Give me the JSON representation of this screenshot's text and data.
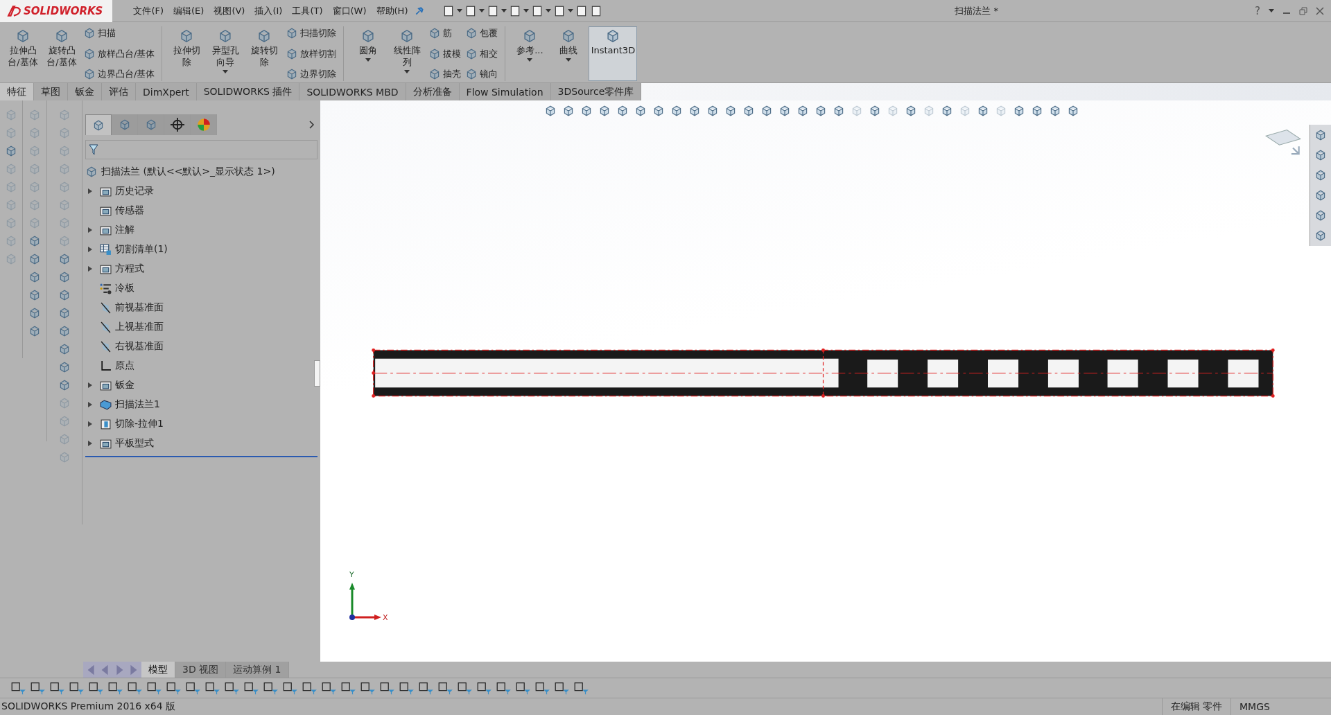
{
  "app_logo": "SOLIDWORKS",
  "menu": [
    "文件(F)",
    "编辑(E)",
    "视图(V)",
    "插入(I)",
    "工具(T)",
    "窗口(W)",
    "帮助(H)"
  ],
  "document_title": "扫描法兰 *",
  "help": "?",
  "ribbon": [
    {
      "kind": "large",
      "label": "拉伸凸台/基体",
      "dropdown": false,
      "on": false
    },
    {
      "kind": "large",
      "label": "旋转凸台/基体",
      "dropdown": false,
      "on": false
    },
    {
      "kind": "stack",
      "items": [
        "扫描",
        "放样凸台/基体",
        "边界凸台/基体"
      ]
    },
    {
      "kind": "separator"
    },
    {
      "kind": "large",
      "label": "拉伸切除",
      "dropdown": false,
      "on": false
    },
    {
      "kind": "large",
      "label": "异型孔向导",
      "dropdown": true,
      "on": false
    },
    {
      "kind": "large",
      "label": "旋转切除",
      "dropdown": false,
      "on": false
    },
    {
      "kind": "stack",
      "items": [
        "扫描切除",
        "放样切割",
        "边界切除"
      ]
    },
    {
      "kind": "separator"
    },
    {
      "kind": "large",
      "label": "圆角",
      "dropdown": true,
      "on": false
    },
    {
      "kind": "large",
      "label": "线性阵列",
      "dropdown": true,
      "on": false
    },
    {
      "kind": "stack",
      "items": [
        "筋",
        "拔模",
        "抽壳"
      ]
    },
    {
      "kind": "stack",
      "items": [
        "包覆",
        "相交",
        "镜向"
      ]
    },
    {
      "kind": "separator"
    },
    {
      "kind": "large",
      "label": "参考...",
      "dropdown": true,
      "on": false
    },
    {
      "kind": "large",
      "label": "曲线",
      "dropdown": true,
      "on": false
    },
    {
      "kind": "large",
      "label": "Instant3D",
      "dropdown": false,
      "on": true
    }
  ],
  "command_tabs": [
    {
      "label": "特征",
      "selected": true
    },
    {
      "label": "草图",
      "selected": false
    },
    {
      "label": "钣金",
      "selected": false
    },
    {
      "label": "评估",
      "selected": false
    },
    {
      "label": "DimXpert",
      "selected": false
    },
    {
      "label": "SOLIDWORKS 插件",
      "selected": false
    },
    {
      "label": "SOLIDWORKS MBD",
      "selected": false
    },
    {
      "label": "分析准备",
      "selected": false
    },
    {
      "label": "Flow Simulation",
      "selected": false
    },
    {
      "label": "3DSource零件库",
      "selected": false
    }
  ],
  "panel_tabs": [
    {
      "selected": true
    },
    {
      "selected": false
    },
    {
      "selected": false
    },
    {
      "selected": false
    },
    {
      "selected": false
    }
  ],
  "feature_tree": {
    "root": "扫描法兰 (默认<<默认>_显示状态 1>)",
    "items": [
      {
        "label": "历史记录",
        "kind": "folder",
        "expandable": true
      },
      {
        "label": "传感器",
        "kind": "folder",
        "expandable": false
      },
      {
        "label": "注解",
        "kind": "folder",
        "expandable": true
      },
      {
        "label": "切割清单(1)",
        "kind": "list",
        "expandable": true
      },
      {
        "label": "方程式",
        "kind": "folder",
        "expandable": true
      },
      {
        "label": "冷板",
        "kind": "config",
        "expandable": false
      },
      {
        "label": "前视基准面",
        "kind": "plane",
        "expandable": false
      },
      {
        "label": "上视基准面",
        "kind": "plane",
        "expandable": false
      },
      {
        "label": "右视基准面",
        "kind": "plane",
        "expandable": false
      },
      {
        "label": "原点",
        "kind": "origin",
        "expandable": false
      },
      {
        "label": "钣金",
        "kind": "folder",
        "expandable": true
      },
      {
        "label": "扫描法兰1",
        "kind": "sweep",
        "expandable": true
      },
      {
        "label": "切除-拉伸1",
        "kind": "feature",
        "expandable": true
      },
      {
        "label": "平板型式",
        "kind": "folder",
        "expandable": true
      }
    ]
  },
  "triad": {
    "x_label": "X",
    "y_label": "Y"
  },
  "view_tabs": [
    {
      "label": "模型",
      "selected": true
    },
    {
      "label": "3D 视图",
      "selected": false
    },
    {
      "label": "运动算例 1",
      "selected": false
    }
  ],
  "status_bar": {
    "product": "SOLIDWORKS Premium 2016 x64 版",
    "mode": "在编辑 零件",
    "units": "MMGS"
  }
}
